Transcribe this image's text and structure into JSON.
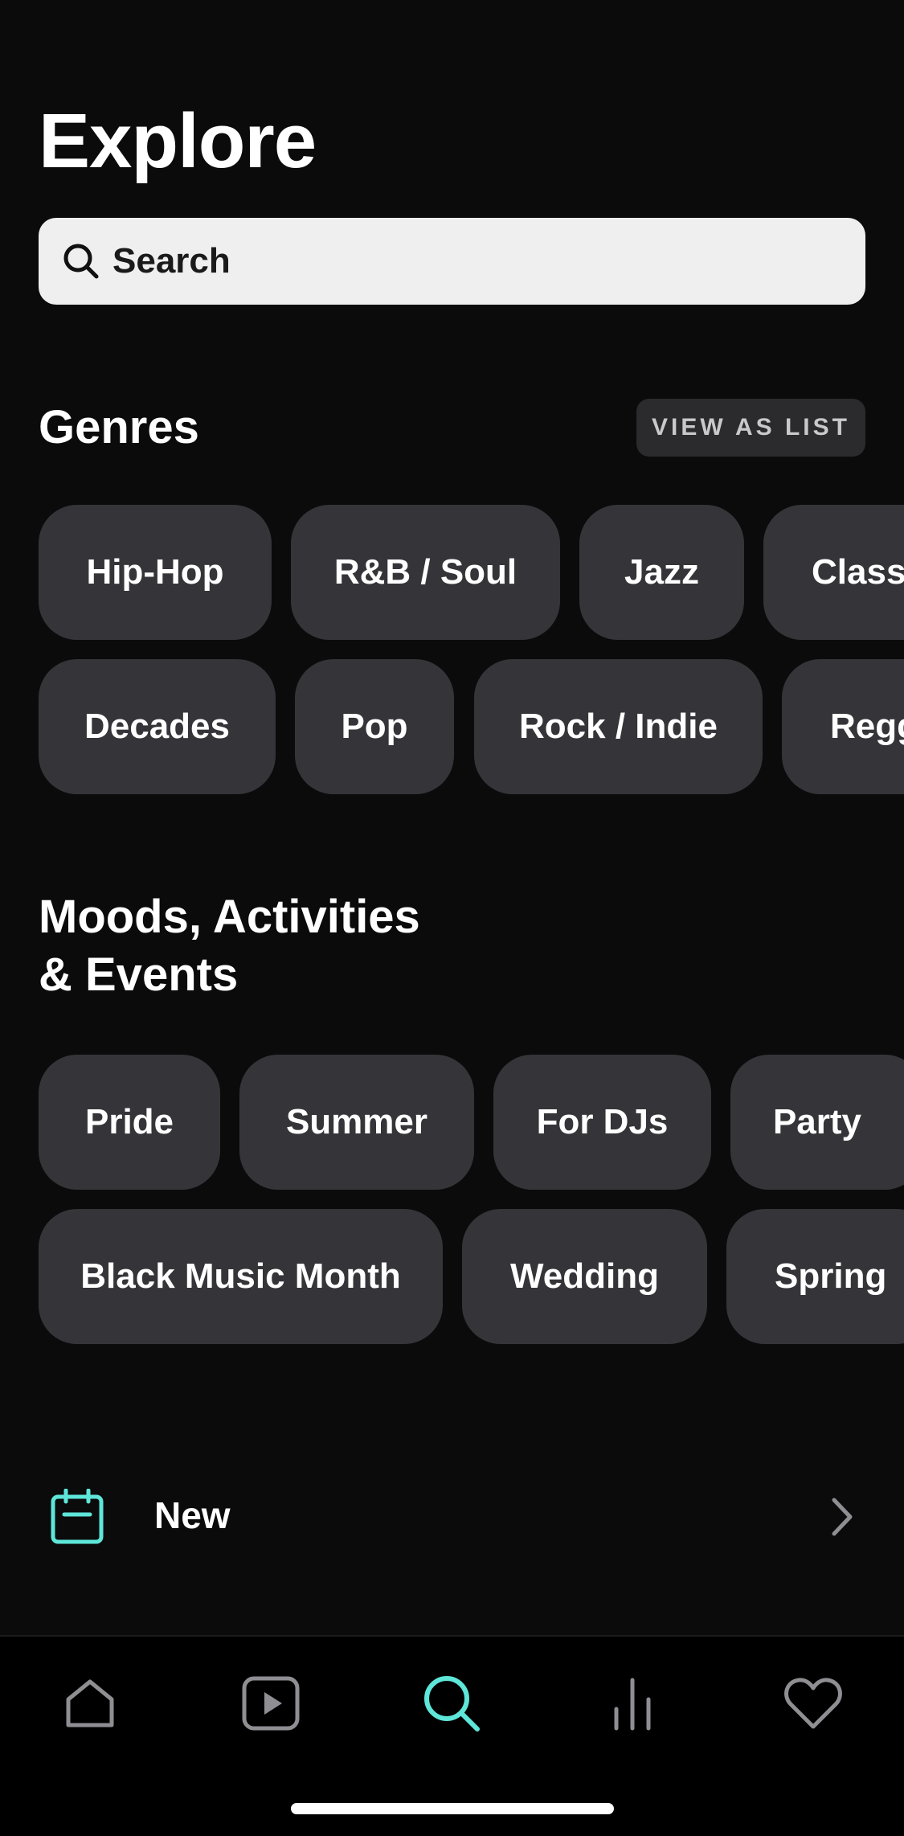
{
  "header": {
    "title": "Explore"
  },
  "search": {
    "placeholder": "Search"
  },
  "genres": {
    "title": "Genres",
    "view_as_list_label": "VIEW AS LIST",
    "row1": [
      "Hip-Hop",
      "R&B / Soul",
      "Jazz",
      "Classi"
    ],
    "row2": [
      "Decades",
      "Pop",
      "Rock / Indie",
      "Regg"
    ]
  },
  "moods": {
    "title_line1": "Moods, Activities",
    "title_line2": "& Events",
    "row1": [
      "Pride",
      "Summer",
      "For DJs",
      "Party"
    ],
    "row2": [
      "Black Music Month",
      "Wedding",
      "Spring"
    ]
  },
  "new_row": {
    "label": "New",
    "icon": "calendar-icon"
  },
  "tab_bar": {
    "items": [
      {
        "icon": "home-icon",
        "active": false
      },
      {
        "icon": "video-play-icon",
        "active": false
      },
      {
        "icon": "search-icon",
        "active": true
      },
      {
        "icon": "equalizer-bars-icon",
        "active": false
      },
      {
        "icon": "heart-icon",
        "active": false
      }
    ]
  },
  "colors": {
    "background": "#0b0b0c",
    "chip": "#353539",
    "accent": "#5ee6d9",
    "inactive_icon": "#8e8e93"
  }
}
